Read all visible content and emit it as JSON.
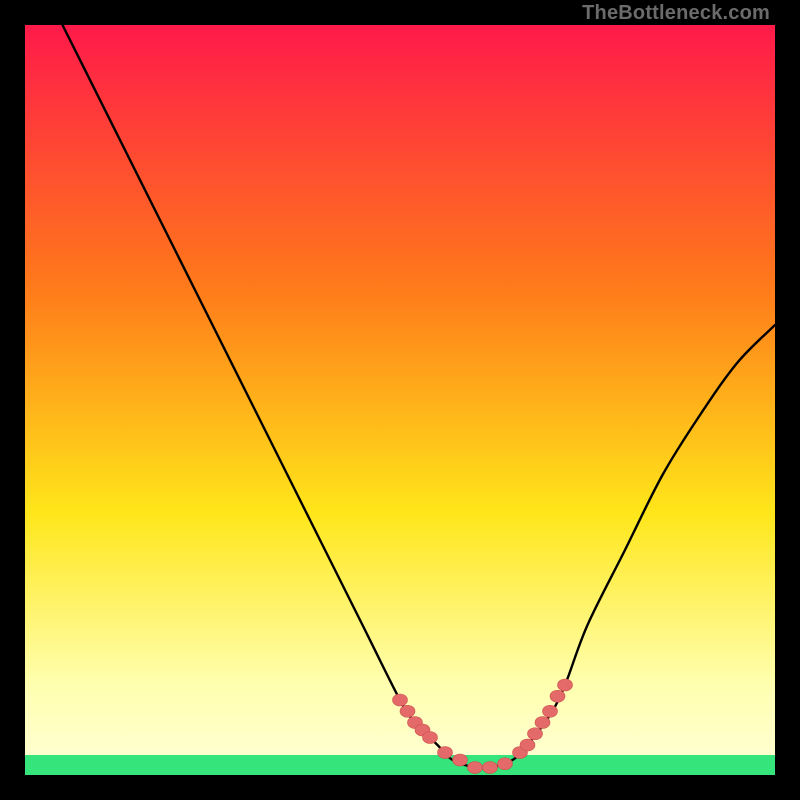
{
  "watermark": "TheBottleneck.com",
  "colors": {
    "background": "#000000",
    "gradient_top": "#ff1a4a",
    "gradient_mid1": "#ff7a1a",
    "gradient_mid2": "#ffe61a",
    "gradient_bottom_pale": "#ffffb0",
    "green_band": "#35e57c",
    "curve_stroke": "#000000",
    "marker_fill": "#e46a6a",
    "marker_stroke": "#cc4e4e"
  },
  "chart_data": {
    "type": "line",
    "title": "",
    "xlabel": "",
    "ylabel": "",
    "xlim": [
      0,
      100
    ],
    "ylim": [
      0,
      100
    ],
    "series": [
      {
        "name": "bottleneck-curve",
        "x": [
          5,
          10,
          15,
          20,
          25,
          30,
          35,
          40,
          45,
          50,
          52,
          55,
          57,
          60,
          62,
          65,
          67,
          70,
          72,
          75,
          80,
          85,
          90,
          95,
          100
        ],
        "y": [
          100,
          90,
          80,
          70,
          60,
          50,
          40,
          30,
          20,
          10,
          7,
          4,
          2,
          1,
          1,
          2,
          4,
          8,
          12,
          20,
          30,
          40,
          48,
          55,
          60
        ]
      }
    ],
    "markers": {
      "name": "highlight-points",
      "x": [
        50,
        51,
        52,
        53,
        54,
        56,
        58,
        60,
        62,
        64,
        66,
        67,
        68,
        69,
        70,
        71,
        72
      ],
      "y": [
        10,
        8.5,
        7,
        6,
        5,
        3,
        2,
        1,
        1,
        1.5,
        3,
        4,
        5.5,
        7,
        8.5,
        10.5,
        12
      ]
    }
  }
}
